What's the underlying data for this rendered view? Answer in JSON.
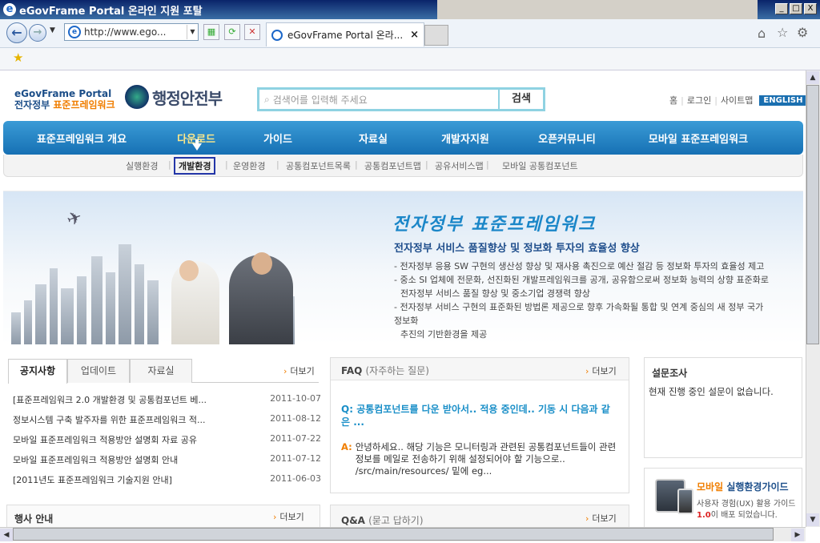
{
  "window": {
    "title": "eGovFrame Portal 온라인 지원 포탈",
    "controls": [
      "_",
      "□",
      "X"
    ]
  },
  "browser": {
    "address": "http://www.ego...",
    "tab_title": "eGovFrame Portal 온라...",
    "tab_close": "×"
  },
  "header": {
    "logo_line1": "eGovFrame Portal",
    "logo_line2a": "전자정부",
    "logo_line2b": "표준프레임워크",
    "ministry": "행정안전부",
    "search_placeholder": "검색어를 입력해 주세요",
    "search_button": "검색",
    "util": [
      "홈",
      "로그인",
      "사이트맵"
    ],
    "util_sep": "|",
    "english": "ENGLISH"
  },
  "gnb": [
    "표준프레임워크 개요",
    "다운로드",
    "가이드",
    "자료실",
    "개발자지원",
    "오픈커뮤니티",
    "모바일 표준프레임워크"
  ],
  "lnb": [
    "실행환경",
    "개발환경",
    "운영환경",
    "공통컴포넌트목록",
    "공통컴포넌트맵",
    "공유서비스맵",
    "모바일 공통컴포넌트"
  ],
  "banner": {
    "title": "전자정부 표준프레임워크",
    "subtitle": "전자정부 서비스 품질향상 및 정보화 투자의 효율성 향상",
    "lines": [
      "- 전자정부 응용 SW 구현의 생산성 향상 및 재사용 촉진으로 예산 절감 등 정보화 투자의 효율성 제고",
      "- 중소 SI 업체에 전문화, 선진화된 개발프레임워크를 공개, 공유함으로써 정보화 능력의 상향 표준화로",
      "  전자정부 서비스 품질 향상 및 중소기업 경쟁력 향상",
      "- 전자정부 서비스 구현의 표준화된 방법론 제공으로 향후 가속화될 통합 및 연계 중심의 새 정부 국가정보화",
      "  추진의 기반환경을 제공"
    ]
  },
  "notice": {
    "tabs": [
      "공지사항",
      "업데이트",
      "자료실"
    ],
    "more": "더보기",
    "items": [
      {
        "title": "[표준프레임워크 2.0 개발환경 및 공통컴포넌트 베...",
        "date": "2011-10-07"
      },
      {
        "title": "정보시스템 구축 발주자를 위한 표준프레임워크 적...",
        "date": "2011-08-12"
      },
      {
        "title": "모바일 표준프레임워크 적용방안 설명회 자료 공유",
        "date": "2011-07-22"
      },
      {
        "title": "모바일 표준프레임워크 적용방안 설명회 안내",
        "date": "2011-07-12"
      },
      {
        "title": "[2011년도 표준프레임워크 기술지원 안내]",
        "date": "2011-06-03"
      }
    ]
  },
  "events": {
    "title": "행사 안내",
    "more": "더보기"
  },
  "faq": {
    "title": "FAQ",
    "title_sub": "(자주하는 질문)",
    "more": "더보기",
    "q_mark": "Q:",
    "question": "공통컴포넌트를 다운 받아서.. 적용 중인데.. 기동 시 다음과 같은 ...",
    "a_mark": "A:",
    "answer": "안녕하세요.. 해당 기능은 모니터링과 관련된 공통컴포넌트들이 관련 정보를 메일로 전송하기 위해 설정되어야 할 기능으로.. /src/main/resources/ 밑에 eg..."
  },
  "qna": {
    "title": "Q&A",
    "title_sub": "(묻고 답하기)",
    "more": "더보기"
  },
  "survey": {
    "title": "설문조사",
    "text": "현재 진행 중인 설문이 없습니다."
  },
  "mobile_guide": {
    "title_a": "모바일",
    "title_b": "실행환경가이드",
    "line1": "사용자 경험(UX) 활용 가이드",
    "line2_a": "1.0",
    "line2_b": "이 배포 되었습니다."
  }
}
